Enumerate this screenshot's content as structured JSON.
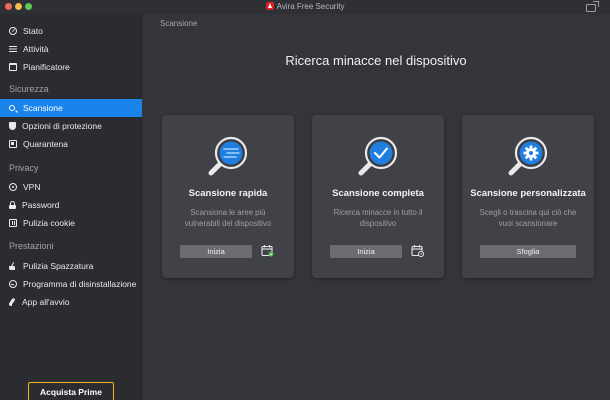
{
  "app": {
    "title": "Avira Free Security"
  },
  "sidebar": {
    "top_items": [
      {
        "label": "Stato",
        "icon": "gauge-icon"
      },
      {
        "label": "Attività",
        "icon": "list-icon"
      },
      {
        "label": "Pianificatore",
        "icon": "calendar-icon"
      }
    ],
    "sections": [
      {
        "label": "Sicurezza",
        "items": [
          {
            "label": "Scansione",
            "icon": "search-icon",
            "active": true
          },
          {
            "label": "Opzioni di protezione",
            "icon": "shield-icon"
          },
          {
            "label": "Quarantena",
            "icon": "quarantine-box-icon"
          }
        ]
      },
      {
        "label": "Privacy",
        "items": [
          {
            "label": "VPN",
            "icon": "vpn-icon"
          },
          {
            "label": "Password",
            "icon": "lock-icon"
          },
          {
            "label": "Pulizia cookie",
            "icon": "cookie-icon"
          }
        ]
      },
      {
        "label": "Prestazioni",
        "items": [
          {
            "label": "Pulizia Spazzatura",
            "icon": "broom-icon"
          },
          {
            "label": "Programma di disinstallazione",
            "icon": "uninstall-icon"
          },
          {
            "label": "App all'avvio",
            "icon": "rocket-icon"
          }
        ]
      }
    ],
    "buy_button": "Acquista Prime"
  },
  "main": {
    "breadcrumb": "Scansione",
    "title": "Ricerca minacce nel dispositivo",
    "cards": [
      {
        "title": "Scansione rapida",
        "description": "Scansiona le aree più vulnerabili del dispositivo",
        "button": "Inizia",
        "icon": "quick-scan-icon",
        "schedule_icon": "schedule-calendar-icon"
      },
      {
        "title": "Scansione completa",
        "description": "Ricerca minacce in tutto il dispositivo",
        "button": "Inizia",
        "icon": "full-scan-icon",
        "schedule_icon": "schedule-calendar-icon"
      },
      {
        "title": "Scansione personalizzata",
        "description": "Scegli o trascina qui ciò che vuoi scansionare",
        "button": "Sfoglia",
        "icon": "custom-scan-icon"
      }
    ]
  },
  "colors": {
    "accent": "#1b84ea",
    "sidebar_bg": "#2b2c30",
    "main_bg": "#333539",
    "card_bg": "#404247",
    "prime_border": "#f2b622",
    "scan_badge": "#1f7fe0"
  }
}
